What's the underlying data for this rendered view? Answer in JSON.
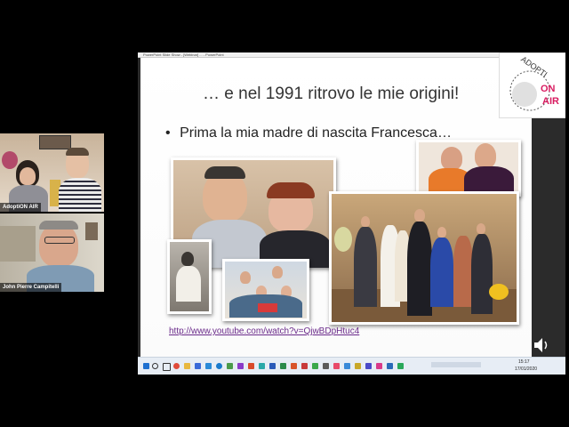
{
  "participants": [
    {
      "name": "AdoptiON AIR"
    },
    {
      "name": "John Pierre Campitelli"
    }
  ],
  "ppt_window_title": "PowerPoint Slide Show - [Webinar] ... - PowerPoint",
  "slide": {
    "title": "… e nel 1991 ritrovo le mie origini!",
    "bullet_symbol": "•",
    "bullet": "Prima la mia madre di nascita Francesca…",
    "link": "http://www.youtube.com/watch?v=QjwBDpHtuc4",
    "logo_text": [
      "ADOPTI",
      "ON",
      "AIR"
    ]
  },
  "taskbar": {
    "start_icon": "windows-icon",
    "search_icon": "search-icon",
    "time": "15:17",
    "date": "17/01/2020"
  },
  "colors": {
    "slide_bg": "#ffffff",
    "logo_red": "#d81b60",
    "link": "#6a2a8a"
  },
  "speaker_icon": "speaker-icon"
}
